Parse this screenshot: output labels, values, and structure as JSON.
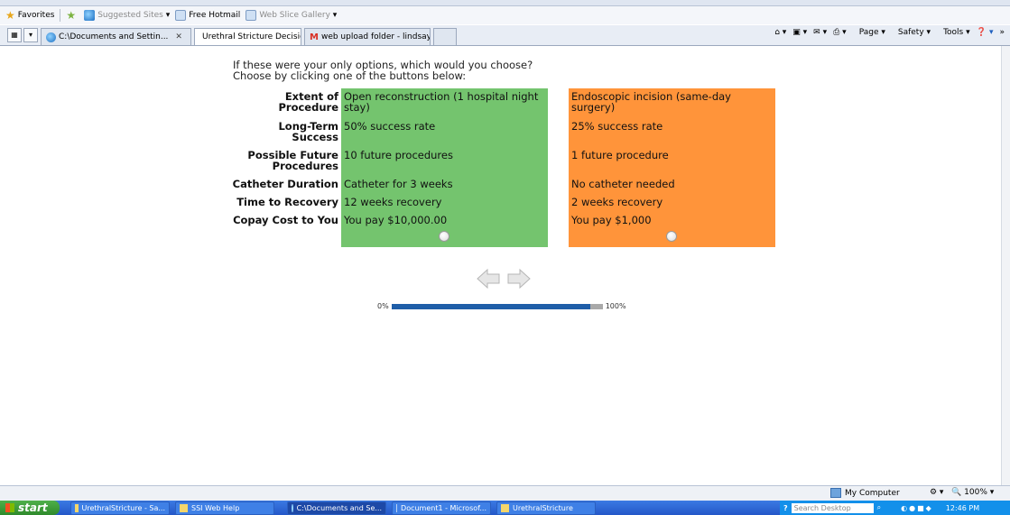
{
  "favorites_bar": {
    "favorites": "Favorites",
    "suggested_sites": "Suggested Sites",
    "free_hotmail": "Free Hotmail",
    "web_slice_gallery": "Web Slice Gallery"
  },
  "tabs": [
    {
      "label": "C:\\Documents and Settin...",
      "active": false
    },
    {
      "label": "Urethral Stricture Decision A...",
      "active": true
    },
    {
      "label": "web upload folder - lindsay.h...",
      "active": false
    }
  ],
  "command_bar": {
    "page": "Page",
    "safety": "Safety",
    "tools": "Tools"
  },
  "survey": {
    "question_line1": "If these were your only options, which would you choose?",
    "question_line2": "Choose by clicking one of the buttons below:",
    "attributes": [
      "Extent of\nProcedure",
      "Long-Term\nSuccess",
      "Possible Future\nProcedures",
      "Catheter Duration",
      "Time to Recovery",
      "Copay Cost to You"
    ],
    "option_a": {
      "color": "#74c46e",
      "values": [
        "Open reconstruction (1 hospital night stay)",
        "50% success rate",
        "10 future procedures",
        "Catheter for 3 weeks",
        "12 weeks recovery",
        "You pay $10,000.00"
      ]
    },
    "option_b": {
      "color": "#ff943a",
      "values": [
        "Endoscopic incision (same-day surgery)",
        "25% success rate",
        "1 future procedure",
        "No catheter needed",
        "2 weeks recovery",
        "You pay $1,000"
      ]
    }
  },
  "progress": {
    "min_label": "0%",
    "max_label": "100%",
    "value_fraction": 0.94
  },
  "status_bar": {
    "zone": "My Computer",
    "zoom": "100%"
  },
  "taskbar": {
    "start": "start",
    "items": [
      "UrethralStricture - Sa...",
      "SSI Web Help",
      "C:\\Documents and Se...",
      "Document1 - Microsof...",
      "UrethralStricture"
    ],
    "search_placeholder": "Search Desktop",
    "clock": "12:46 PM"
  }
}
